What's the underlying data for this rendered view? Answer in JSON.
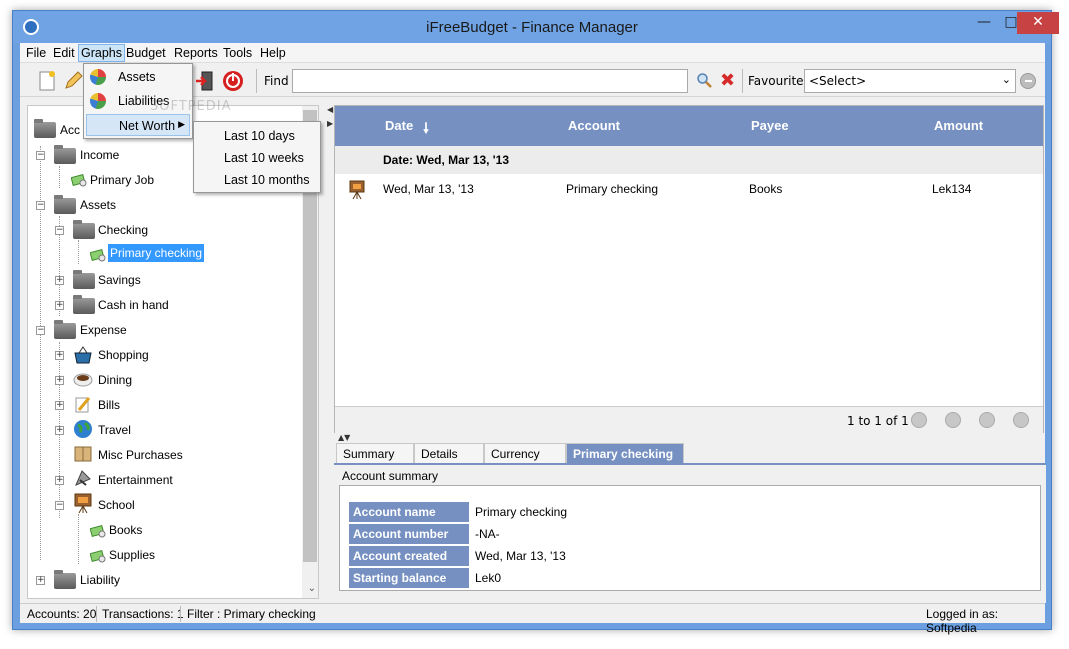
{
  "window": {
    "title": "iFreeBudget - Finance Manager"
  },
  "menu": {
    "items": [
      "File",
      "Edit",
      "Graphs",
      "Budget",
      "Reports",
      "Tools",
      "Help"
    ],
    "graphs_dropdown": [
      "Assets",
      "Liabilities",
      "Net Worth"
    ],
    "net_worth_submenu": [
      "Last 10 days",
      "Last 10 weeks",
      "Last 10 months"
    ]
  },
  "toolbar": {
    "find_label": "Find",
    "find_value": "",
    "favourites_label": "Favourites",
    "favourites_selected": "<Select>"
  },
  "tree": {
    "root_label": "Acc",
    "nodes": [
      {
        "label": "Income"
      },
      {
        "label": "Primary Job"
      },
      {
        "label": "Assets"
      },
      {
        "label": "Checking"
      },
      {
        "label": "Primary checking"
      },
      {
        "label": "Savings"
      },
      {
        "label": "Cash in hand"
      },
      {
        "label": "Expense"
      },
      {
        "label": "Shopping"
      },
      {
        "label": "Dining"
      },
      {
        "label": "Bills"
      },
      {
        "label": "Travel"
      },
      {
        "label": "Misc Purchases"
      },
      {
        "label": "Entertainment"
      },
      {
        "label": "School"
      },
      {
        "label": "Books"
      },
      {
        "label": "Supplies"
      },
      {
        "label": "Liability"
      }
    ]
  },
  "grid": {
    "columns": [
      "Date",
      "Account",
      "Payee",
      "Amount"
    ],
    "group_label": "Date: Wed, Mar 13, '13",
    "rows": [
      {
        "date": "Wed, Mar 13, '13",
        "account": "Primary checking",
        "payee": "Books",
        "amount": "Lek134"
      }
    ],
    "pager_text": "1 to 1 of 1"
  },
  "tabs": [
    "Summary",
    "Details",
    "Currency",
    "Primary checking"
  ],
  "summary": {
    "title": "Account summary",
    "fields": [
      {
        "key": "Account name",
        "value": "Primary checking"
      },
      {
        "key": "Account number",
        "value": "-NA-"
      },
      {
        "key": "Account created on",
        "value": "Wed, Mar 13, '13"
      },
      {
        "key": "Starting balance",
        "value": "Lek0"
      }
    ]
  },
  "status": {
    "accounts": "Accounts: 20",
    "transactions": "Transactions: 1",
    "filter": "Filter : Primary checking",
    "logged_in": "Logged in as: Softpedia"
  },
  "watermark": "SOFTPEDIA",
  "colors": {
    "header_blue": "#7590c1",
    "selection_blue": "#3399ff",
    "close_red": "#c74343"
  }
}
